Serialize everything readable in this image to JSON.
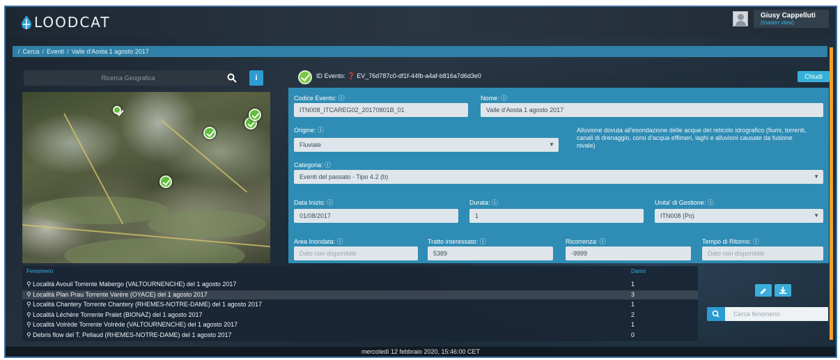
{
  "header": {
    "logo_text": "LOODCAT",
    "user": {
      "name": "Giusy Cappelluti",
      "role": "(master view)"
    }
  },
  "breadcrumb": [
    "Cerca",
    "Eventi",
    "Valle d'Aosta 1 agosto 2017"
  ],
  "geo_search": {
    "placeholder": "Ricerca Geografica",
    "info_label": "i"
  },
  "event": {
    "id_label": "ID Evento:",
    "id_value": "EV_76d787c0-df1f-44fb-a4af-b816a7d6d3e0",
    "close_label": "Chiudi",
    "fields": {
      "codice": {
        "label": "Codice Evento:",
        "value": "ITN008_ITCAREG02_20170801B_01"
      },
      "nome": {
        "label": "Nome:",
        "value": "Valle d'Aosta 1 agosto 2017"
      },
      "origine": {
        "label": "Origine:",
        "value": "Fluviale"
      },
      "origine_desc": "Alluvione dovuta all'esondazione delle acque del reticolo idrografico (fiumi, torrenti, canali di drenaggio, corsi d'acqua effimeri, laghi e alluvioni causate da fusione nivale)",
      "categoria": {
        "label": "Categoria:",
        "value": "Eventi del passato - Tipo 4.2 (b)"
      },
      "data_inizio": {
        "label": "Data Inizio:",
        "value": "01/08/2017"
      },
      "durata": {
        "label": "Durata:",
        "value": "1"
      },
      "unita_gestione": {
        "label": "Unita' di Gestione:",
        "value": "ITN008 (Po)"
      },
      "area_inondata": {
        "label": "Area Inondata:",
        "placeholder": "Dato non disponibile"
      },
      "tratto": {
        "label": "Tratto interessato:",
        "value": "5389"
      },
      "ricorrenza": {
        "label": "Ricorrenza:",
        "value": "-9999"
      },
      "tempo_ritorno": {
        "label": "Tempo di Ritorno:",
        "placeholder": "Dato non disponibile"
      }
    }
  },
  "table": {
    "headers": {
      "fenomeno": "Fenomeno",
      "danni": "Danni"
    },
    "rows": [
      {
        "name": "Località Avouil Torrente Mabergo (VALTOURNENCHE) del 1 agosto 2017",
        "danni": "1"
      },
      {
        "name": "Località Plan Prau Torrente Varère (OYACE) del 1 agosto 2017",
        "danni": "3"
      },
      {
        "name": "Località Chantery Torrente Chantery (RHEMES-NOTRE-DAME) del 1 agosto 2017",
        "danni": "1"
      },
      {
        "name": "Località Léchère Torrente Pralet (BIONAZ) del 1 agosto 2017",
        "danni": "2"
      },
      {
        "name": "Località Volrède Torrente Volrède (VALTOURNENCHE) del 1 agosto 2017",
        "danni": "1"
      },
      {
        "name": "Debris flow del T. Pellaud (RHEMES-NOTRE-DAME) del 1 agosto 2017",
        "danni": "0"
      }
    ],
    "highlighted_row": 1
  },
  "fenomeno_search": {
    "placeholder": "Cerca fenomeno"
  },
  "footer": {
    "datetime": "mercoledì 12 febbraio 2020, 15:46:00 CET"
  },
  "colors": {
    "accent": "#2c9bd1",
    "form_bg": "#2f8cb4",
    "orange": "#f2a12a",
    "marker": "#5fbf3c"
  }
}
